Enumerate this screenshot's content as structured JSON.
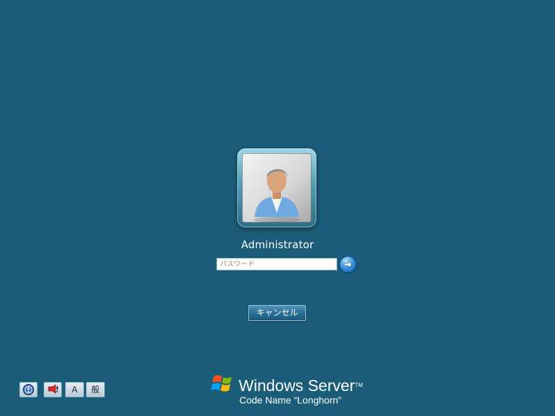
{
  "logon": {
    "user_name": "Administrator",
    "password_placeholder": "パスワード",
    "cancel_label": "キャンセル"
  },
  "tray": {
    "ime_mode_label": "A",
    "ime_kanji_label": "般"
  },
  "branding": {
    "product_name": "Windows Server",
    "trademark": "TM",
    "subtitle": "Code Name “Longhorn”"
  },
  "icons": {
    "user_avatar": "user-avatar-icon",
    "submit": "arrow-right-icon",
    "ease_of_access": "ease-of-access-icon",
    "alert": "alert-icon",
    "flag": "windows-flag-icon"
  },
  "colors": {
    "background": "#1b5d78",
    "accent": "#3a97e0"
  }
}
